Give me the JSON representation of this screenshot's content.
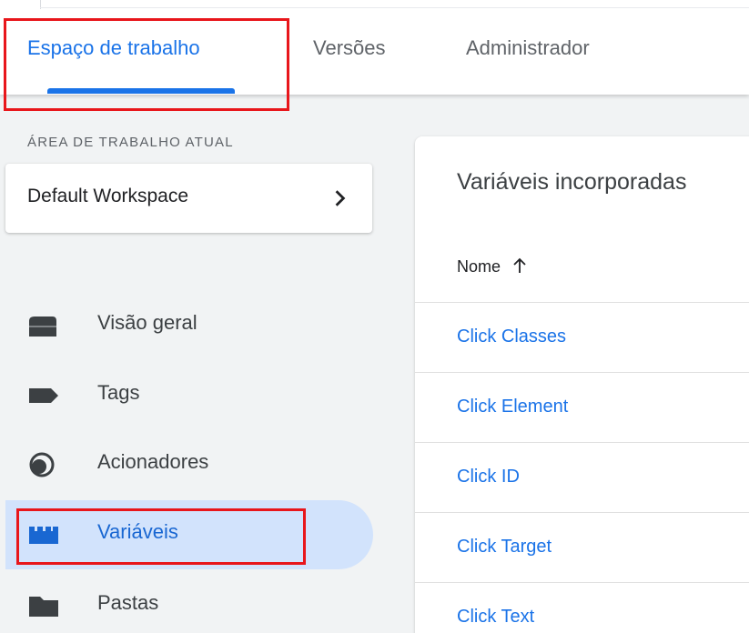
{
  "header": {
    "tabs": [
      {
        "label": "Espaço de trabalho",
        "active": true
      },
      {
        "label": "Versões",
        "active": false
      },
      {
        "label": "Administrador",
        "active": false
      }
    ]
  },
  "sidebar": {
    "section_label": "ÁREA DE TRABALHO ATUAL",
    "workspace": {
      "name": "Default Workspace",
      "icon": "chevron-right-icon"
    },
    "items": [
      {
        "label": "Visão geral",
        "icon": "overview-icon",
        "active": false
      },
      {
        "label": "Tags",
        "icon": "tag-icon",
        "active": false
      },
      {
        "label": "Acionadores",
        "icon": "trigger-icon",
        "active": false
      },
      {
        "label": "Variáveis",
        "icon": "variables-icon",
        "active": true
      },
      {
        "label": "Pastas",
        "icon": "folder-icon",
        "active": false
      }
    ]
  },
  "main": {
    "title": "Variáveis incorporadas",
    "column_header": "Nome",
    "sort_icon": "arrow-up-icon",
    "rows": [
      "Click Classes",
      "Click Element",
      "Click ID",
      "Click Target",
      "Click Text"
    ]
  },
  "colors": {
    "accent": "#1a73e8",
    "active_nav_bg": "#d2e3fc",
    "annotation_red": "#e8161b",
    "sidebar_bg": "#f1f3f4"
  }
}
